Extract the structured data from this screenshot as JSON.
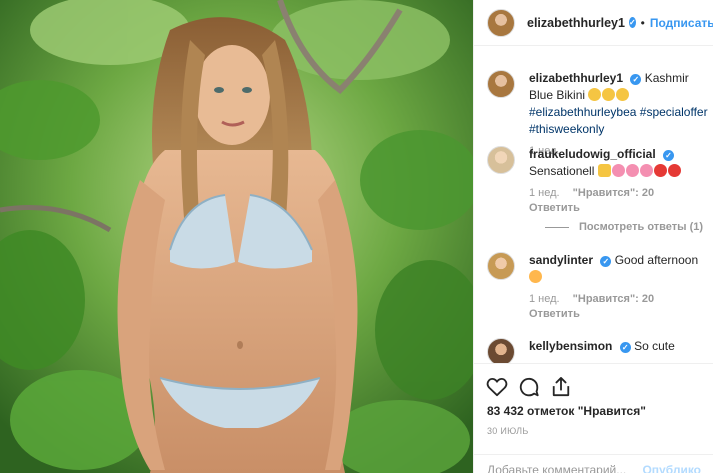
{
  "post": {
    "username": "elizabethhurley1",
    "follow_label": "Подписаться",
    "separator": "•"
  },
  "caption": {
    "username": "elizabethhurley1",
    "text": "Kashmir Blue Bikini",
    "emojis": [
      "🙂",
      "🙂",
      "🙂"
    ],
    "hashtags": [
      "#elizabethhurleybea",
      "#specialoffer",
      "#thisweekonly"
    ],
    "time": "1 нед."
  },
  "comments": [
    {
      "username": "fraukeludowig_official",
      "text": "Sensationell",
      "emojis": [
        "👍",
        "🌸",
        "🌸",
        "🌸",
        "❤",
        "❤"
      ],
      "time": "1 нед.",
      "likes": "\"Нравится\": 20",
      "reply": "Ответить",
      "view_replies": "Посмотреть ответы (1)"
    },
    {
      "username": "sandylinter",
      "text": "Good afternoon",
      "emojis": [
        "💐"
      ],
      "time": "1 нед.",
      "likes": "\"Нравится\": 20",
      "reply": "Ответить"
    },
    {
      "username": "kellybensimon",
      "text": "So cute"
    }
  ],
  "actions": {
    "likes_count": "83 432 отметок \"Нравится\"",
    "date": "30 ИЮЛЬ",
    "comment_placeholder": "Добавьте комментарий...",
    "post_label": "Опублико"
  },
  "colors": {
    "accent": "#3897f0",
    "muted": "#999999",
    "hashtag": "#003569"
  }
}
